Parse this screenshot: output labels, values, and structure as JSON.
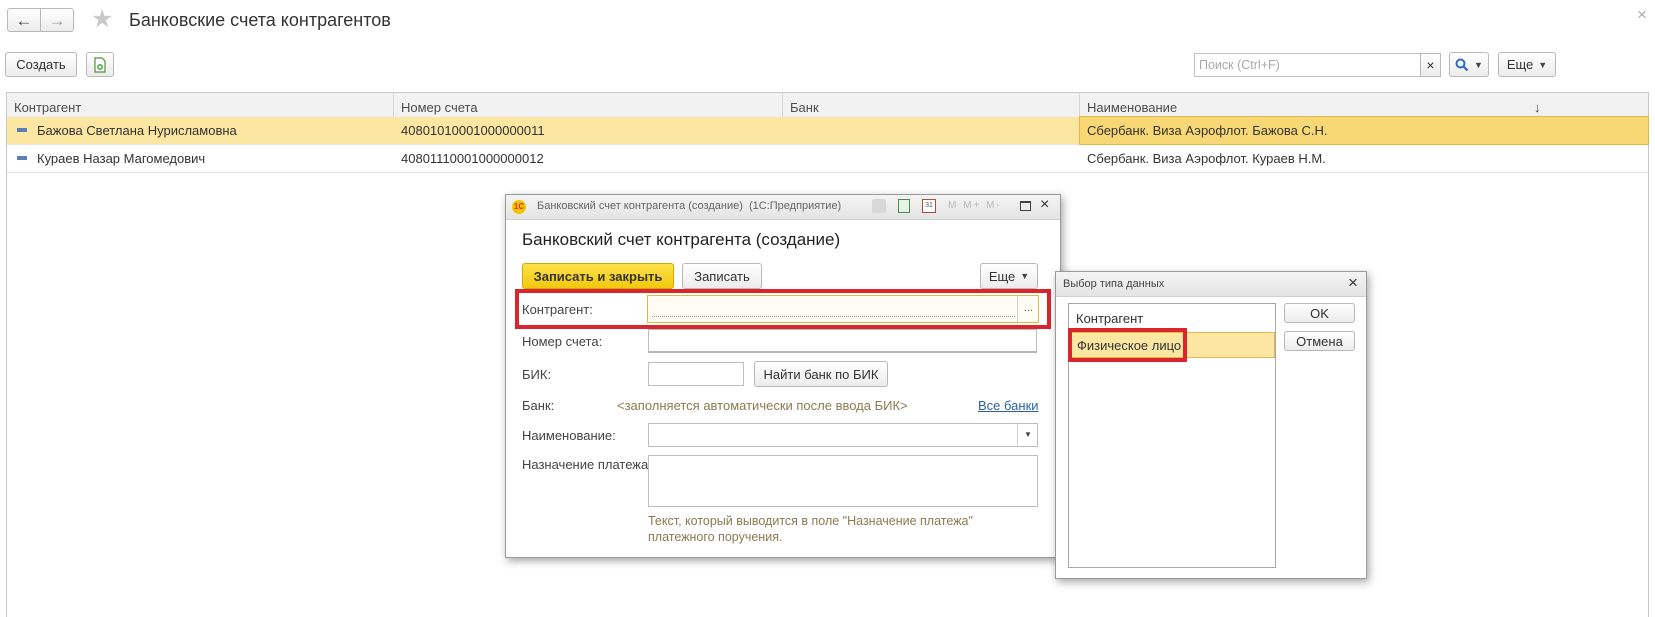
{
  "page": {
    "title": "Банковские счета контрагентов"
  },
  "toolbar": {
    "create_label": "Создать",
    "search_placeholder": "Поиск (Ctrl+F)",
    "search_clear": "×",
    "more_label": "Еще"
  },
  "table": {
    "columns": [
      "Контрагент",
      "Номер счета",
      "Банк",
      "Наименование"
    ],
    "sort_indicator": "↓",
    "rows": [
      {
        "counterparty": "Бажова Светлана Нурисламовна",
        "account": "40801010001000000011",
        "bank": "",
        "name": "Сбербанк. Виза Аэрофлот. Бажова С.Н."
      },
      {
        "counterparty": "Кураев Назар Магомедович",
        "account": "40801110001000000012",
        "bank": "",
        "name": "Сбербанк. Виза Аэрофлот. Кураев Н.М."
      }
    ]
  },
  "form": {
    "window_title": "Банковский счет контрагента (создание)  (1С:Предприятие)",
    "heading": "Банковский счет контрагента (создание)",
    "save_close_label": "Записать и закрыть",
    "save_label": "Записать",
    "more_label": "Еще",
    "counterparty_label": "Контрагент:",
    "counterparty_select": "...",
    "account_label": "Номер счета:",
    "bik_label": "БИК:",
    "find_bank_label": "Найти банк по БИК",
    "bank_label": "Банк:",
    "bank_hint": "<заполняется автоматически после ввода БИК>",
    "all_banks_link": "Все банки",
    "name_label": "Наименование:",
    "purpose_label": "Назначение платежа:",
    "purpose_hint_line1": "Текст, который выводится в поле \"Назначение платежа\"",
    "purpose_hint_line2": "платежного поручения."
  },
  "type_dialog": {
    "title": "Выбор типа данных",
    "options": [
      "Контрагент",
      "Физическое лицо"
    ],
    "selected_index": 1,
    "ok_label": "OK",
    "cancel_label": "Отмена"
  },
  "colors": {
    "selection": "#fbe6a2",
    "primary_button": "#f5d21a",
    "highlight_border": "#d9252b",
    "link": "#2b5fa8",
    "hint": "#8a7a50"
  }
}
